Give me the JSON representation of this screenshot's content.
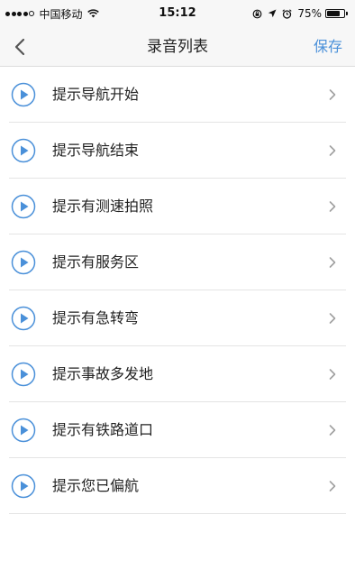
{
  "status_bar": {
    "carrier": "中国移动",
    "time": "15:12",
    "battery_percent_label": "75%",
    "battery_level": 0.75,
    "signal_bars_filled": 4,
    "signal_bars_total": 5,
    "icons": [
      "wifi-icon",
      "lock-rotation-icon",
      "location-arrow-icon",
      "alarm-icon",
      "battery-icon"
    ]
  },
  "nav": {
    "title": "录音列表",
    "save_label": "保存",
    "back_icon": "chevron-left-icon"
  },
  "colors": {
    "accent": "#4a90d9",
    "bar_background": "#f7f7f7",
    "separator": "#e4e4e4",
    "chevron": "#a0a0a0"
  },
  "recordings": [
    {
      "label": "提示导航开始"
    },
    {
      "label": "提示导航结束"
    },
    {
      "label": "提示有测速拍照"
    },
    {
      "label": "提示有服务区"
    },
    {
      "label": "提示有急转弯"
    },
    {
      "label": "提示事故多发地"
    },
    {
      "label": "提示有铁路道口"
    },
    {
      "label": "提示您已偏航"
    }
  ]
}
